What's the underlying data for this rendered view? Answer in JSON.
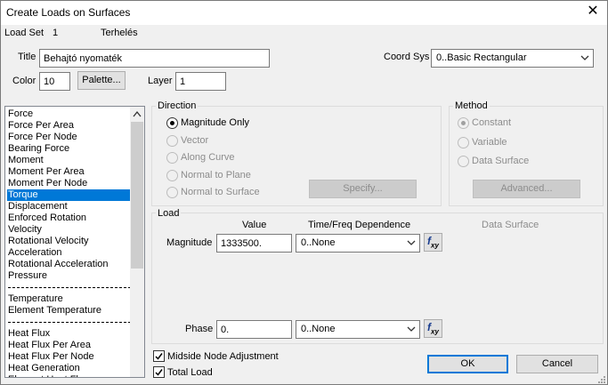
{
  "window": {
    "title": "Create Loads on Surfaces",
    "close_label": "✕"
  },
  "load_set": {
    "label": "Load Set",
    "number": "1",
    "name": "Terhelés"
  },
  "title_field": {
    "label": "Title",
    "value": "Behajtó nyomaték"
  },
  "coord_sys": {
    "label": "Coord Sys",
    "value": "0..Basic Rectangular"
  },
  "color": {
    "label": "Color",
    "value": "10",
    "palette_label": "Palette..."
  },
  "layer": {
    "label": "Layer",
    "value": "1"
  },
  "load_types": {
    "group1": [
      "Force",
      "Force Per Area",
      "Force Per Node",
      "Bearing Force",
      "Moment",
      "Moment Per Area",
      "Moment Per Node",
      "Torque",
      "Displacement",
      "Enforced Rotation",
      "Velocity",
      "Rotational Velocity",
      "Acceleration",
      "Rotational Acceleration",
      "Pressure"
    ],
    "group2": [
      "Temperature",
      "Element Temperature"
    ],
    "group3": [
      "Heat Flux",
      "Heat Flux Per Area",
      "Heat Flux Per Node",
      "Heat Generation",
      "Element Heat Flux"
    ],
    "selected": "Torque"
  },
  "direction": {
    "title": "Direction",
    "options": [
      "Magnitude Only",
      "Vector",
      "Along Curve",
      "Normal to Plane",
      "Normal to Surface"
    ],
    "selected": "Magnitude Only",
    "specify_label": "Specify..."
  },
  "method": {
    "title": "Method",
    "options": [
      "Constant",
      "Variable",
      "Data Surface"
    ],
    "selected": "Constant",
    "advanced_label": "Advanced..."
  },
  "load": {
    "title": "Load",
    "col_value": "Value",
    "col_time": "Time/Freq Dependence",
    "col_data_surface": "Data Surface",
    "magnitude_label": "Magnitude",
    "magnitude_value": "1333500.",
    "magnitude_dependence": "0..None",
    "phase_label": "Phase",
    "phase_value": "0.",
    "phase_dependence": "0..None",
    "fx_label": "f",
    "fx_sub": "xy"
  },
  "options": {
    "midside": {
      "label": "Midside Node Adjustment",
      "checked": true
    },
    "total_load": {
      "label": "Total Load",
      "checked": true
    }
  },
  "buttons": {
    "ok": "OK",
    "cancel": "Cancel"
  }
}
